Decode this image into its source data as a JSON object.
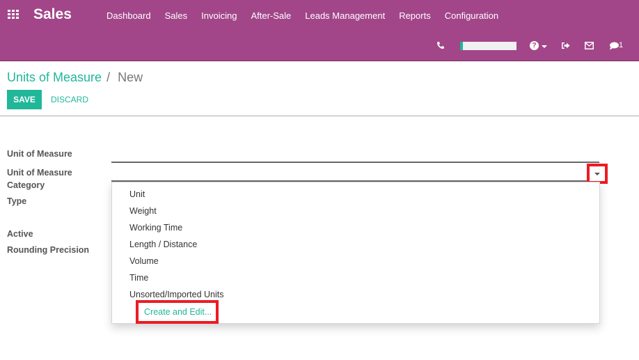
{
  "navbar": {
    "app_title": "Sales",
    "menu": [
      "Dashboard",
      "Sales",
      "Invoicing",
      "After-Sale",
      "Leads Management",
      "Reports",
      "Configuration"
    ],
    "systray": {
      "icons": [
        "phone-icon",
        "help-icon",
        "logout-icon",
        "mail-icon",
        "chat-icon"
      ],
      "help_glyph": "?",
      "chat_count": "1"
    },
    "accent_color": "#a24689"
  },
  "breadcrumb": {
    "parent": "Units of Measure",
    "separator": "/",
    "current": "New"
  },
  "buttons": {
    "save": "SAVE",
    "discard": "DISCARD"
  },
  "form": {
    "labels": {
      "unit_of_measure": "Unit of Measure",
      "category_line1": "Unit of Measure",
      "category_line2": "Category",
      "type": "Type",
      "active": "Active",
      "rounding_precision": "Rounding Precision"
    },
    "values": {
      "unit_of_measure": "",
      "category": ""
    }
  },
  "category_dropdown": {
    "options": [
      "Unit",
      "Weight",
      "Working Time",
      "Length / Distance",
      "Volume",
      "Time",
      "Unsorted/Imported Units"
    ],
    "create_edit": "Create and Edit..."
  },
  "colors": {
    "primary": "#21b799",
    "highlight": "#ec1c24"
  }
}
